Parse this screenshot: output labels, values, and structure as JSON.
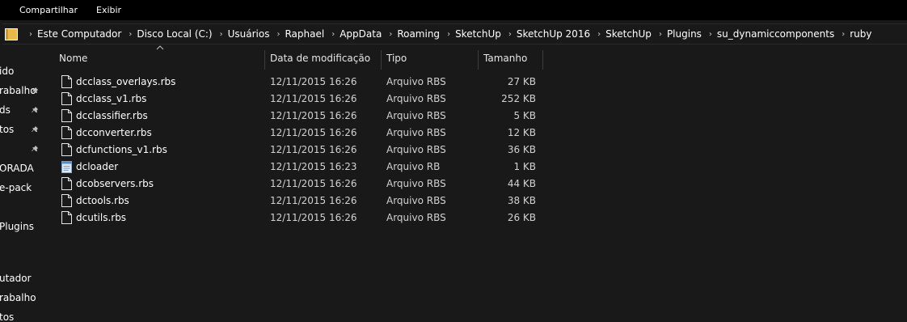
{
  "menu": [
    "Compartilhar",
    "Exibir"
  ],
  "breadcrumbs": [
    "Este Computador",
    "Disco Local (C:)",
    "Usuários",
    "Raphael",
    "AppData",
    "Roaming",
    "SketchUp",
    "SketchUp 2016",
    "SketchUp",
    "Plugins",
    "su_dynamiccomponents",
    "ruby"
  ],
  "nav": {
    "items": [
      "ido",
      "rabalho",
      "ds",
      "tos",
      "",
      "ORADA",
      "e-pack",
      "",
      "Plugins",
      "",
      "utador",
      "rabalho",
      "tos"
    ]
  },
  "columns": {
    "name": "Nome",
    "date": "Data de modificação",
    "type": "Tipo",
    "size": "Tamanho"
  },
  "files": [
    {
      "name": "dcclass_overlays.rbs",
      "date": "12/11/2015 16:26",
      "type": "Arquivo RBS",
      "size": "27 KB",
      "icon": "file-icon"
    },
    {
      "name": "dcclass_v1.rbs",
      "date": "12/11/2015 16:26",
      "type": "Arquivo RBS",
      "size": "252 KB",
      "icon": "file-icon"
    },
    {
      "name": "dcclassifier.rbs",
      "date": "12/11/2015 16:26",
      "type": "Arquivo RBS",
      "size": "5 KB",
      "icon": "file-icon"
    },
    {
      "name": "dcconverter.rbs",
      "date": "12/11/2015 16:26",
      "type": "Arquivo RBS",
      "size": "12 KB",
      "icon": "file-icon"
    },
    {
      "name": "dcfunctions_v1.rbs",
      "date": "12/11/2015 16:26",
      "type": "Arquivo RBS",
      "size": "36 KB",
      "icon": "file-icon"
    },
    {
      "name": "dcloader",
      "date": "12/11/2015 16:23",
      "type": "Arquivo RB",
      "size": "1 KB",
      "icon": "notepad-icon"
    },
    {
      "name": "dcobservers.rbs",
      "date": "12/11/2015 16:26",
      "type": "Arquivo RBS",
      "size": "44 KB",
      "icon": "file-icon"
    },
    {
      "name": "dctools.rbs",
      "date": "12/11/2015 16:26",
      "type": "Arquivo RBS",
      "size": "38 KB",
      "icon": "file-icon"
    },
    {
      "name": "dcutils.rbs",
      "date": "12/11/2015 16:26",
      "type": "Arquivo RBS",
      "size": "26 KB",
      "icon": "file-icon"
    }
  ],
  "colors": {
    "background": "#191919",
    "menubar": "#000000",
    "folder": "#e8b84a"
  }
}
